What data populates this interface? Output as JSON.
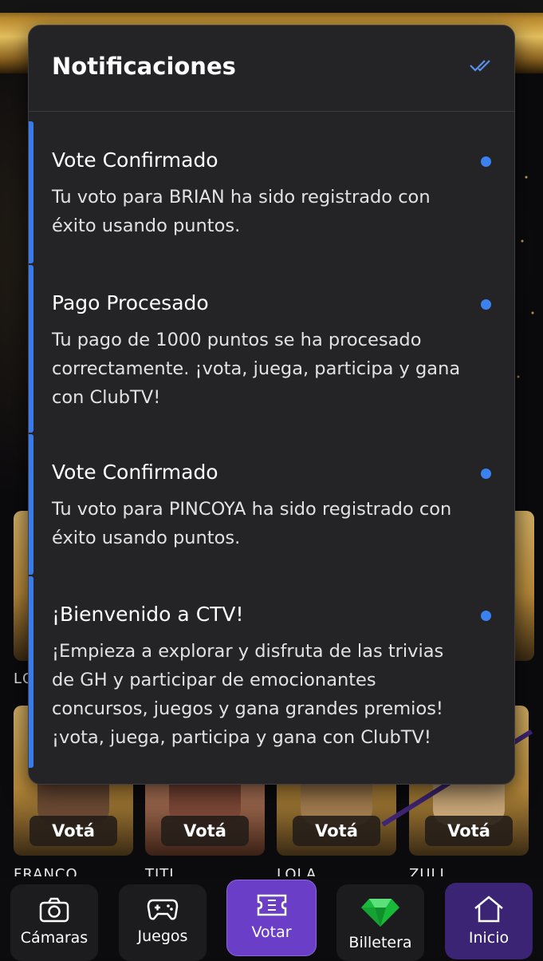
{
  "notifications_panel": {
    "title": "Notificaciones",
    "mark_all_read_icon": "double-check-icon",
    "items": [
      {
        "title": "Vote Confirmado",
        "body": "Tu voto para BRIAN ha sido registrado con éxito usando puntos.",
        "unread": true
      },
      {
        "title": "Pago Procesado",
        "body": "Tu pago de 1000 puntos se ha procesado correctamente. ¡vota, juega, participa y gana con ClubTV!",
        "unread": true
      },
      {
        "title": "Vote Confirmado",
        "body": "Tu voto para PINCOYA ha sido registrado con éxito usando puntos.",
        "unread": true
      },
      {
        "title": "¡Bienvenido a CTV!",
        "body": "¡Empieza a explorar y disfruta de las trivias de GH y participar de emocionantes concursos, juegos y gana grandes premios! ¡vota, juega, participa y gana con ClubTV!",
        "unread": true
      }
    ]
  },
  "background": {
    "partial_label": "LC",
    "cards": [
      {
        "name": "FRANCO",
        "vote_label": "Votá"
      },
      {
        "name": "TITI",
        "vote_label": "Votá"
      },
      {
        "name": "LOLA",
        "vote_label": "Votá"
      },
      {
        "name": "ZULI",
        "vote_label": "Votá"
      }
    ]
  },
  "bottom_nav": {
    "items": [
      {
        "label": "Cámaras",
        "icon": "camera-icon"
      },
      {
        "label": "Juegos",
        "icon": "gamepad-icon"
      },
      {
        "label": "Votar",
        "icon": "ticket-icon",
        "active": true
      },
      {
        "label": "Billetera",
        "icon": "emerald-icon"
      },
      {
        "label": "Inicio",
        "icon": "home-icon"
      }
    ]
  },
  "colors": {
    "panel_bg": "#242426",
    "accent_blue": "#3b82f0",
    "active_nav": "#6a3ec6",
    "gold": "#d4b064"
  }
}
